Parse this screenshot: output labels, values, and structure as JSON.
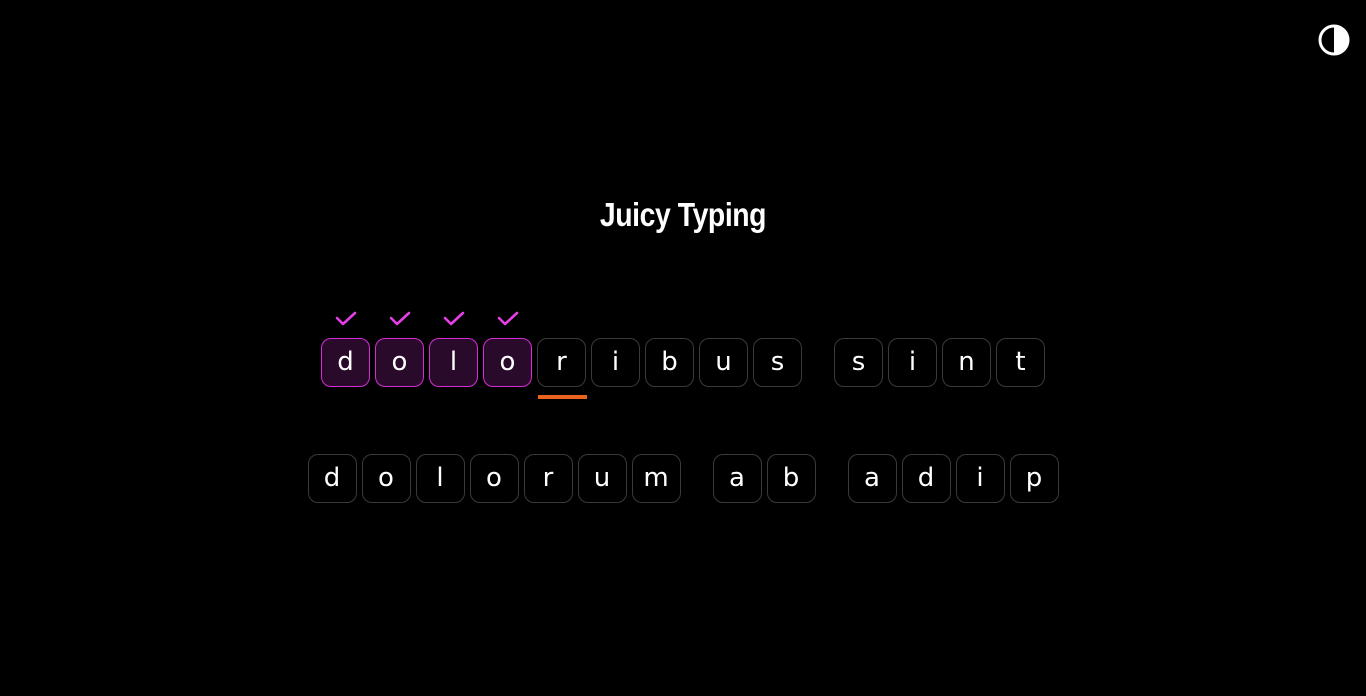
{
  "header": {
    "theme_toggle_icon": "contrast-icon"
  },
  "title": "Juicy Typing",
  "colors": {
    "background": "#000000",
    "text": "#ffffff",
    "typed_border": "#d62bd6",
    "typed_fill": "#2a0a2a",
    "check": "#e53fe5",
    "cursor": "#e8641f",
    "key_border": "#3a3a3a"
  },
  "lines": [
    {
      "words": [
        {
          "letters": [
            {
              "char": "d",
              "status": "correct"
            },
            {
              "char": "o",
              "status": "correct"
            },
            {
              "char": "l",
              "status": "correct"
            },
            {
              "char": "o",
              "status": "correct"
            },
            {
              "char": "r",
              "status": "current"
            },
            {
              "char": "i",
              "status": "pending"
            },
            {
              "char": "b",
              "status": "pending"
            },
            {
              "char": "u",
              "status": "pending"
            },
            {
              "char": "s",
              "status": "pending"
            }
          ]
        },
        {
          "letters": [
            {
              "char": "s",
              "status": "pending"
            },
            {
              "char": "i",
              "status": "pending"
            },
            {
              "char": "n",
              "status": "pending"
            },
            {
              "char": "t",
              "status": "pending"
            }
          ]
        }
      ]
    },
    {
      "words": [
        {
          "letters": [
            {
              "char": "d",
              "status": "pending"
            },
            {
              "char": "o",
              "status": "pending"
            },
            {
              "char": "l",
              "status": "pending"
            },
            {
              "char": "o",
              "status": "pending"
            },
            {
              "char": "r",
              "status": "pending"
            },
            {
              "char": "u",
              "status": "pending"
            },
            {
              "char": "m",
              "status": "pending"
            }
          ]
        },
        {
          "letters": [
            {
              "char": "a",
              "status": "pending"
            },
            {
              "char": "b",
              "status": "pending"
            }
          ]
        },
        {
          "letters": [
            {
              "char": "a",
              "status": "pending"
            },
            {
              "char": "d",
              "status": "pending"
            },
            {
              "char": "i",
              "status": "pending"
            },
            {
              "char": "p",
              "status": "pending"
            }
          ]
        }
      ]
    }
  ]
}
